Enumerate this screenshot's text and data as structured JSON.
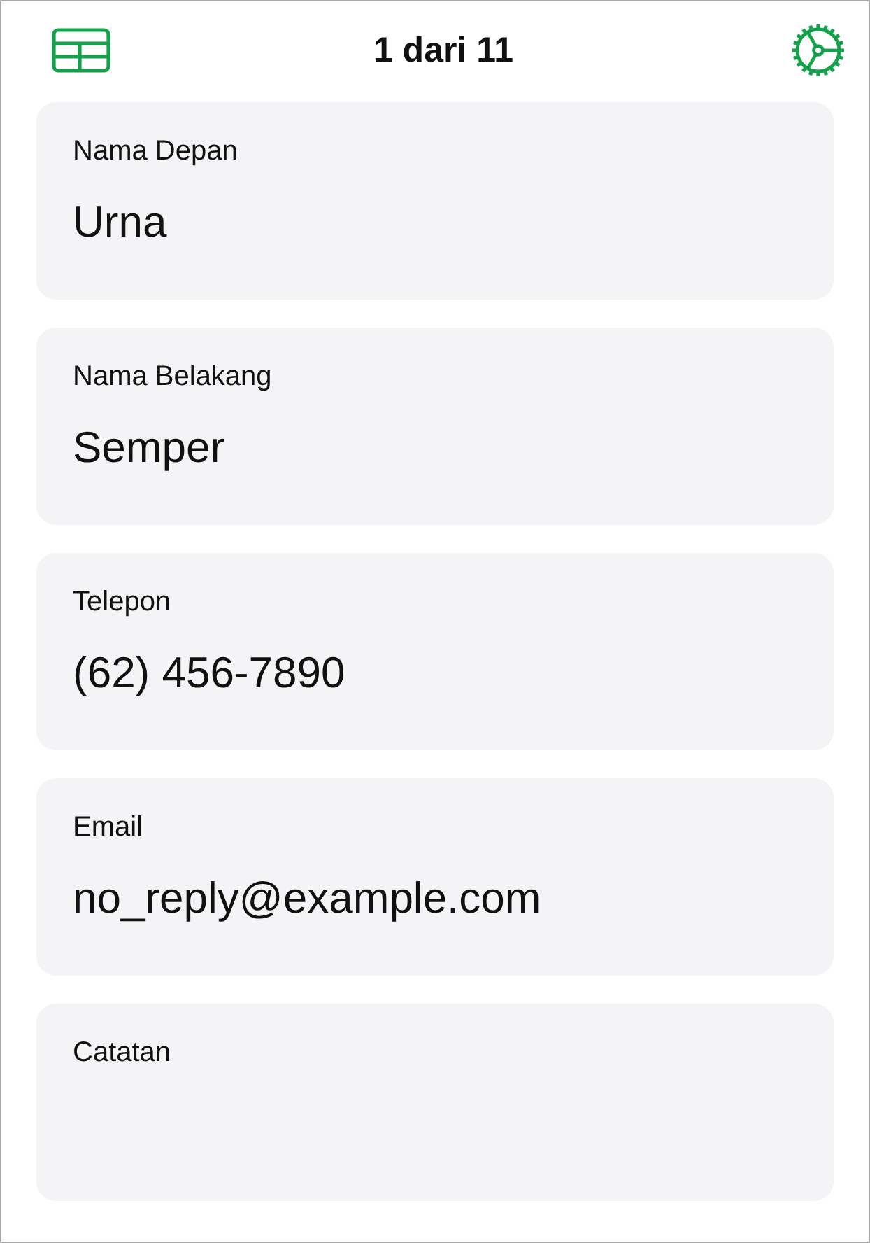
{
  "header": {
    "title": "1 dari 11"
  },
  "fields": [
    {
      "label": "Nama Depan",
      "value": "Urna"
    },
    {
      "label": "Nama Belakang",
      "value": "Semper"
    },
    {
      "label": "Telepon",
      "value": "(62) 456-7890"
    },
    {
      "label": "Email",
      "value": "no_reply@example.com"
    },
    {
      "label": "Catatan"
    }
  ]
}
